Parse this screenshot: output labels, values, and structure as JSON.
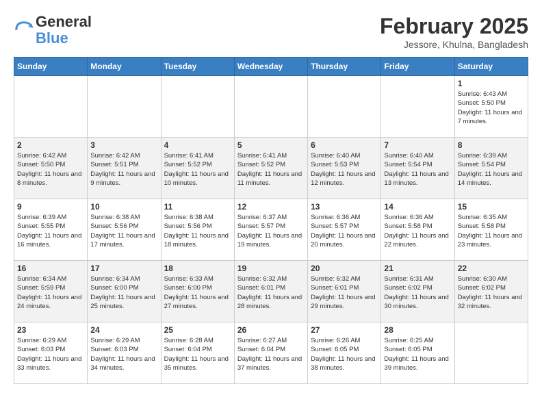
{
  "header": {
    "logo_line1": "General",
    "logo_line2": "Blue",
    "month_title": "February 2025",
    "location": "Jessore, Khulna, Bangladesh"
  },
  "weekdays": [
    "Sunday",
    "Monday",
    "Tuesday",
    "Wednesday",
    "Thursday",
    "Friday",
    "Saturday"
  ],
  "weeks": [
    [
      {
        "day": "",
        "info": ""
      },
      {
        "day": "",
        "info": ""
      },
      {
        "day": "",
        "info": ""
      },
      {
        "day": "",
        "info": ""
      },
      {
        "day": "",
        "info": ""
      },
      {
        "day": "",
        "info": ""
      },
      {
        "day": "1",
        "info": "Sunrise: 6:43 AM\nSunset: 5:50 PM\nDaylight: 11 hours and 7 minutes."
      }
    ],
    [
      {
        "day": "2",
        "info": "Sunrise: 6:42 AM\nSunset: 5:50 PM\nDaylight: 11 hours and 8 minutes."
      },
      {
        "day": "3",
        "info": "Sunrise: 6:42 AM\nSunset: 5:51 PM\nDaylight: 11 hours and 9 minutes."
      },
      {
        "day": "4",
        "info": "Sunrise: 6:41 AM\nSunset: 5:52 PM\nDaylight: 11 hours and 10 minutes."
      },
      {
        "day": "5",
        "info": "Sunrise: 6:41 AM\nSunset: 5:52 PM\nDaylight: 11 hours and 11 minutes."
      },
      {
        "day": "6",
        "info": "Sunrise: 6:40 AM\nSunset: 5:53 PM\nDaylight: 11 hours and 12 minutes."
      },
      {
        "day": "7",
        "info": "Sunrise: 6:40 AM\nSunset: 5:54 PM\nDaylight: 11 hours and 13 minutes."
      },
      {
        "day": "8",
        "info": "Sunrise: 6:39 AM\nSunset: 5:54 PM\nDaylight: 11 hours and 14 minutes."
      }
    ],
    [
      {
        "day": "9",
        "info": "Sunrise: 6:39 AM\nSunset: 5:55 PM\nDaylight: 11 hours and 16 minutes."
      },
      {
        "day": "10",
        "info": "Sunrise: 6:38 AM\nSunset: 5:56 PM\nDaylight: 11 hours and 17 minutes."
      },
      {
        "day": "11",
        "info": "Sunrise: 6:38 AM\nSunset: 5:56 PM\nDaylight: 11 hours and 18 minutes."
      },
      {
        "day": "12",
        "info": "Sunrise: 6:37 AM\nSunset: 5:57 PM\nDaylight: 11 hours and 19 minutes."
      },
      {
        "day": "13",
        "info": "Sunrise: 6:36 AM\nSunset: 5:57 PM\nDaylight: 11 hours and 20 minutes."
      },
      {
        "day": "14",
        "info": "Sunrise: 6:36 AM\nSunset: 5:58 PM\nDaylight: 11 hours and 22 minutes."
      },
      {
        "day": "15",
        "info": "Sunrise: 6:35 AM\nSunset: 5:58 PM\nDaylight: 11 hours and 23 minutes."
      }
    ],
    [
      {
        "day": "16",
        "info": "Sunrise: 6:34 AM\nSunset: 5:59 PM\nDaylight: 11 hours and 24 minutes."
      },
      {
        "day": "17",
        "info": "Sunrise: 6:34 AM\nSunset: 6:00 PM\nDaylight: 11 hours and 25 minutes."
      },
      {
        "day": "18",
        "info": "Sunrise: 6:33 AM\nSunset: 6:00 PM\nDaylight: 11 hours and 27 minutes."
      },
      {
        "day": "19",
        "info": "Sunrise: 6:32 AM\nSunset: 6:01 PM\nDaylight: 11 hours and 28 minutes."
      },
      {
        "day": "20",
        "info": "Sunrise: 6:32 AM\nSunset: 6:01 PM\nDaylight: 11 hours and 29 minutes."
      },
      {
        "day": "21",
        "info": "Sunrise: 6:31 AM\nSunset: 6:02 PM\nDaylight: 11 hours and 30 minutes."
      },
      {
        "day": "22",
        "info": "Sunrise: 6:30 AM\nSunset: 6:02 PM\nDaylight: 11 hours and 32 minutes."
      }
    ],
    [
      {
        "day": "23",
        "info": "Sunrise: 6:29 AM\nSunset: 6:03 PM\nDaylight: 11 hours and 33 minutes."
      },
      {
        "day": "24",
        "info": "Sunrise: 6:29 AM\nSunset: 6:03 PM\nDaylight: 11 hours and 34 minutes."
      },
      {
        "day": "25",
        "info": "Sunrise: 6:28 AM\nSunset: 6:04 PM\nDaylight: 11 hours and 35 minutes."
      },
      {
        "day": "26",
        "info": "Sunrise: 6:27 AM\nSunset: 6:04 PM\nDaylight: 11 hours and 37 minutes."
      },
      {
        "day": "27",
        "info": "Sunrise: 6:26 AM\nSunset: 6:05 PM\nDaylight: 11 hours and 38 minutes."
      },
      {
        "day": "28",
        "info": "Sunrise: 6:25 AM\nSunset: 6:05 PM\nDaylight: 11 hours and 39 minutes."
      },
      {
        "day": "",
        "info": ""
      }
    ]
  ]
}
